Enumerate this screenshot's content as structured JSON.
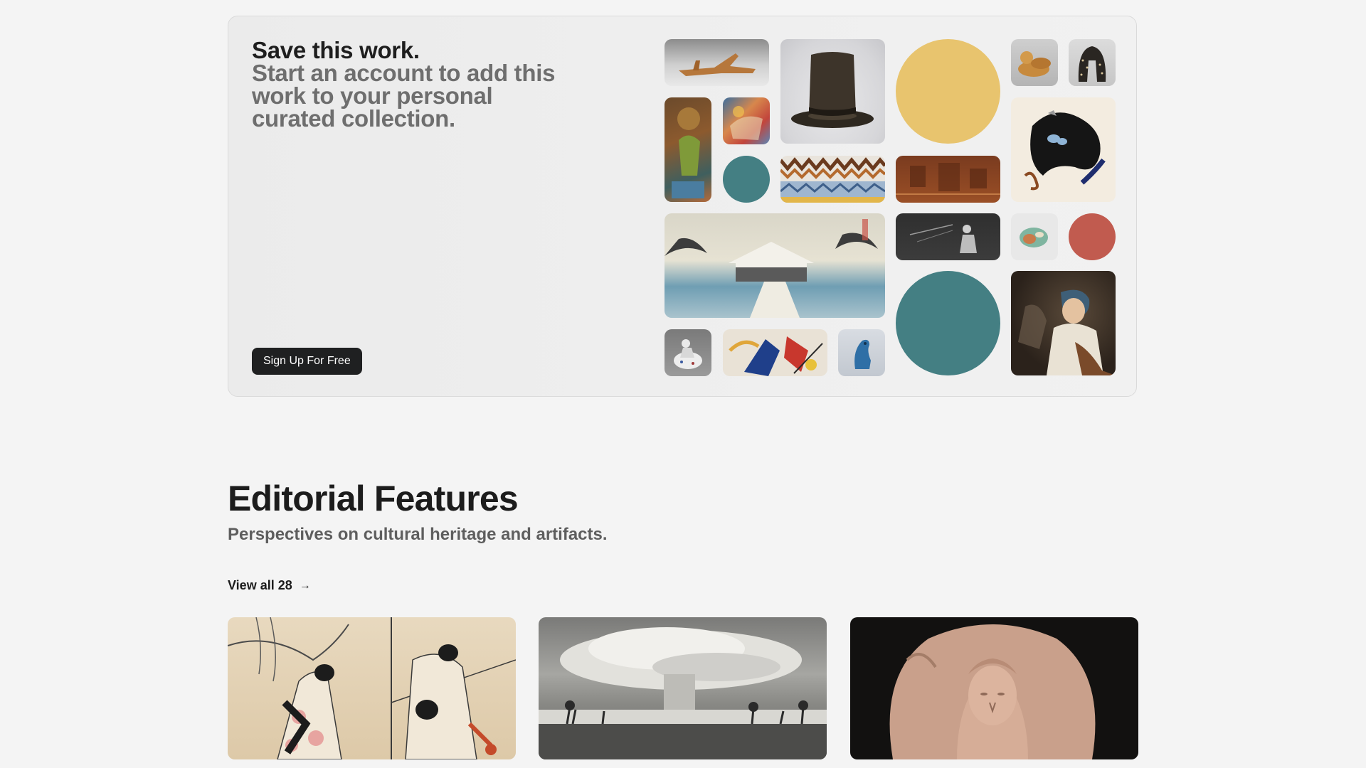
{
  "save_card": {
    "title": "Save this work.",
    "subtitle": "Start an account to add this work to your personal curated collection.",
    "signup_label": "Sign Up For Free"
  },
  "collage": {
    "items": [
      {
        "name": "wooden-carving-thumb"
      },
      {
        "name": "top-hat-thumb"
      },
      {
        "name": "yellow-circle",
        "color": "#e8c46e"
      },
      {
        "name": "carved-duck-thumb"
      },
      {
        "name": "beaded-garment-thumb"
      },
      {
        "name": "figure-painting-thumb"
      },
      {
        "name": "colorful-painting-thumb"
      },
      {
        "name": "teal-circle-small",
        "color": "#447f83"
      },
      {
        "name": "zigzag-textile-thumb"
      },
      {
        "name": "bronze-relief-thumb"
      },
      {
        "name": "abstract-blob-thumb"
      },
      {
        "name": "snow-landscape-print-thumb"
      },
      {
        "name": "fencing-photo-thumb"
      },
      {
        "name": "ceramic-fragment-thumb"
      },
      {
        "name": "red-circle",
        "color": "#c15b4f"
      },
      {
        "name": "teal-circle-large",
        "color": "#447f83"
      },
      {
        "name": "woman-portrait-painting-thumb"
      },
      {
        "name": "porcelain-figurine-thumb"
      },
      {
        "name": "abstract-painting-thumb"
      },
      {
        "name": "blue-bird-figure-thumb"
      }
    ]
  },
  "editorial": {
    "title": "Editorial Features",
    "subtitle": "Perspectives on cultural heritage and artifacts.",
    "view_all": "View all 28",
    "cards": [
      {
        "name": "japanese-print-card"
      },
      {
        "name": "mushroom-cloud-photo-card"
      },
      {
        "name": "stone-sculpture-card"
      }
    ]
  }
}
